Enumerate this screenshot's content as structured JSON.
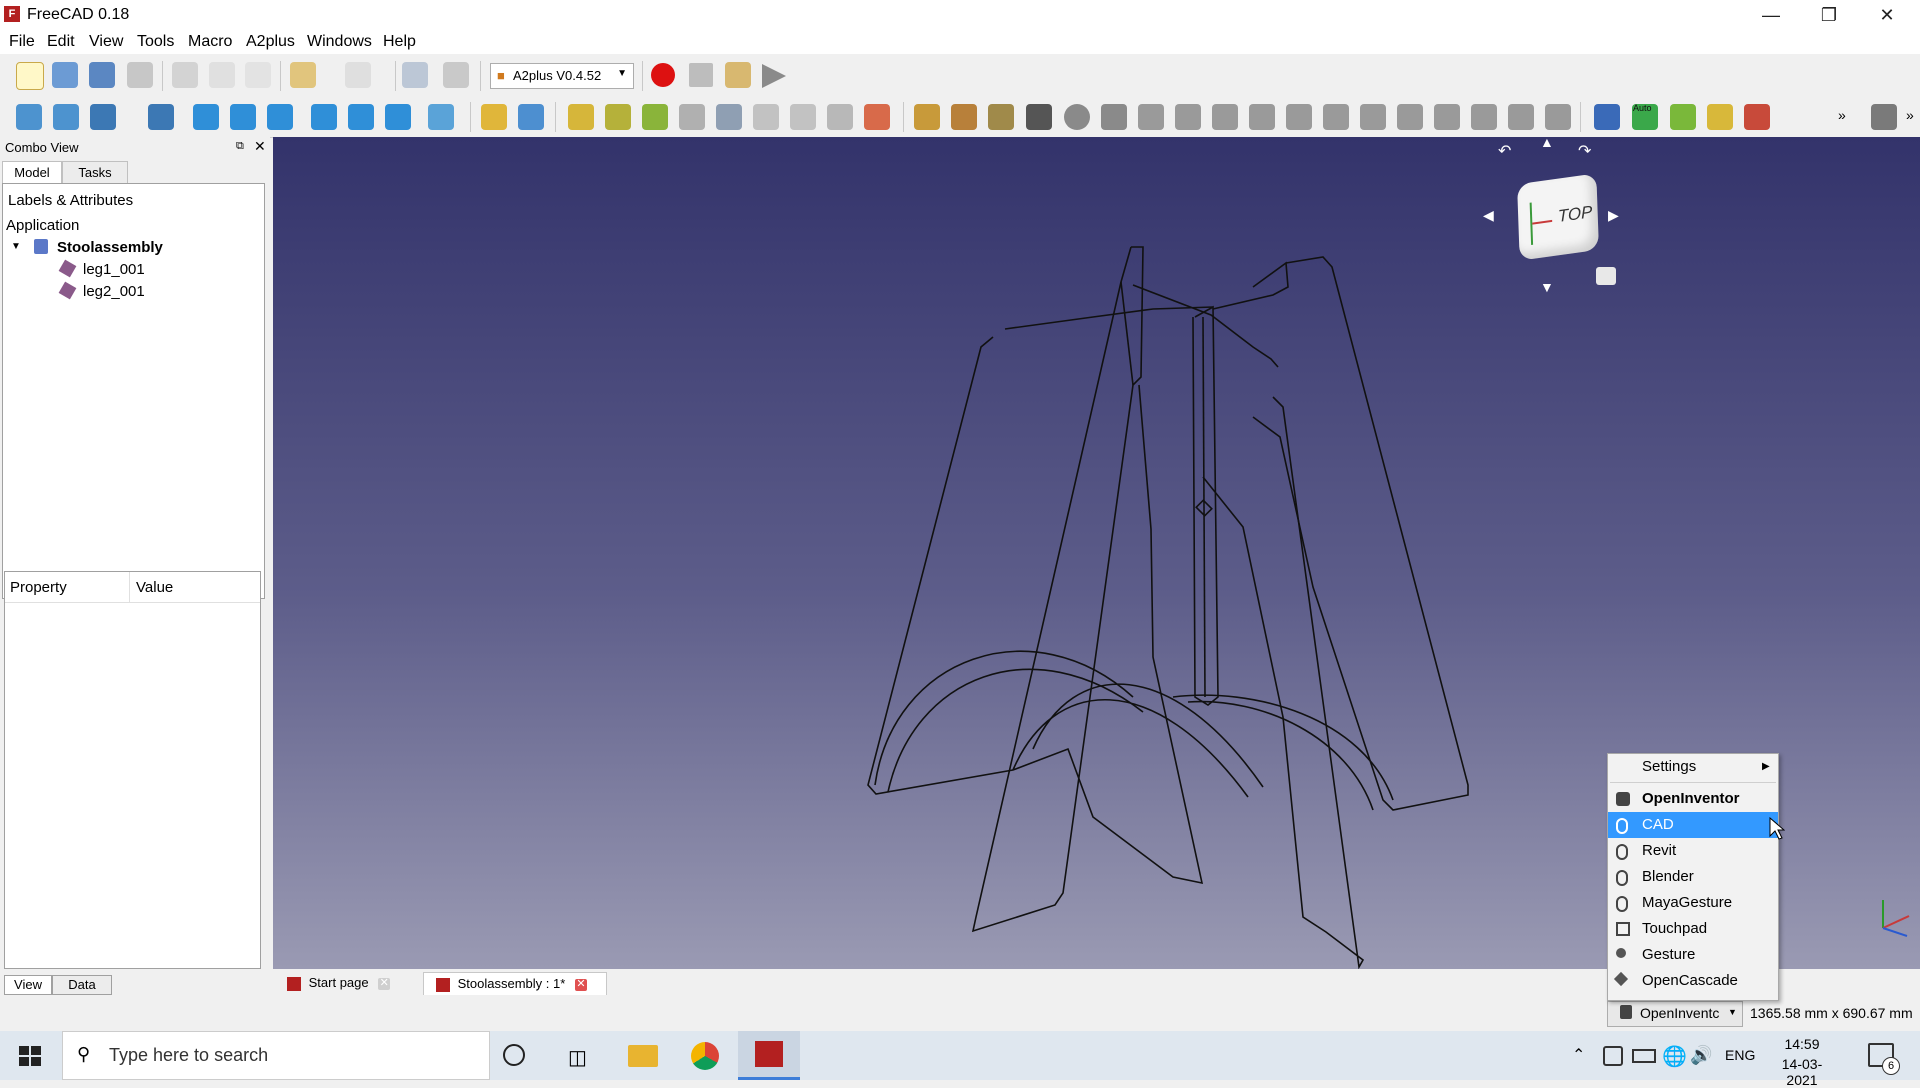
{
  "window": {
    "title": "FreeCAD 0.18",
    "app_icon": "freecad-icon"
  },
  "menubar": [
    "File",
    "Edit",
    "View",
    "Tools",
    "Macro",
    "A2plus",
    "Windows",
    "Help"
  ],
  "toolbar": {
    "workbench_selector": "A2plus V0.4.52"
  },
  "combo_view": {
    "title": "Combo View",
    "tabs": [
      "Model",
      "Tasks"
    ],
    "tree_header": "Labels & Attributes",
    "tree_root": "Application",
    "document": "Stoolassembly",
    "items": [
      "leg1_001",
      "leg2_001"
    ],
    "property_columns": [
      "Property",
      "Value"
    ],
    "bottom_tabs": [
      "View",
      "Data"
    ]
  },
  "navcube": {
    "face_label": "TOP"
  },
  "doc_tabs": [
    "Start page",
    "Stoolassembly : 1*"
  ],
  "nav_menu": {
    "settings": "Settings",
    "items": [
      "OpenInventor",
      "CAD",
      "Revit",
      "Blender",
      "MayaGesture",
      "Touchpad",
      "Gesture",
      "OpenCascade"
    ],
    "selected": "OpenInventor",
    "highlighted": "CAD"
  },
  "statusbar": {
    "nav_style": "OpenInventc",
    "dimensions": "1365.58 mm x 690.67 mm"
  },
  "taskbar": {
    "search_placeholder": "Type here to search",
    "language": "ENG",
    "time": "14:59",
    "date": "14-03-2021",
    "notifications": "6"
  },
  "colors": {
    "highlight": "#3399ff",
    "viewport_top": "#33336b",
    "viewport_bottom": "#9a9ab3"
  }
}
